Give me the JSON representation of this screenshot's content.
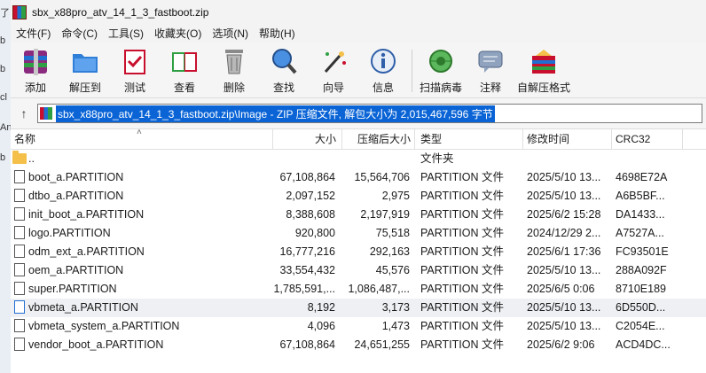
{
  "window": {
    "title": "sbx_x88pro_atv_14_1_3_fastboot.zip"
  },
  "left_strip": [
    "了",
    "b",
    "b",
    "cl",
    "Аn",
    "b"
  ],
  "menu": [
    "文件(F)",
    "命令(C)",
    "工具(S)",
    "收藏夹(O)",
    "选项(N)",
    "帮助(H)"
  ],
  "toolbar": [
    {
      "label": "添加",
      "icon": "add-archive-icon"
    },
    {
      "label": "解压到",
      "icon": "extract-to-icon"
    },
    {
      "label": "测试",
      "icon": "test-icon"
    },
    {
      "label": "查看",
      "icon": "view-book-icon"
    },
    {
      "label": "删除",
      "icon": "trash-icon"
    },
    {
      "label": "查找",
      "icon": "find-magnifier-icon"
    },
    {
      "label": "向导",
      "icon": "wizard-wand-icon"
    },
    {
      "label": "信息",
      "icon": "info-icon"
    },
    {
      "label": "扫描病毒",
      "icon": "virus-scan-icon"
    },
    {
      "label": "注释",
      "icon": "comment-icon"
    },
    {
      "label": "自解压格式",
      "icon": "sfx-icon"
    }
  ],
  "address": {
    "text": "sbx_x88pro_atv_14_1_3_fastboot.zip\\Image - ZIP 压缩文件, 解包大小为 2,015,467,596 字节"
  },
  "columns": {
    "name": "名称",
    "size": "大小",
    "packed": "压缩后大小",
    "type": "类型",
    "modified": "修改时间",
    "crc": "CRC32"
  },
  "files": [
    {
      "name": "..",
      "size": "",
      "packed": "",
      "type": "文件夹",
      "modified": "",
      "crc": ""
    },
    {
      "name": "boot_a.PARTITION",
      "size": "67,108,864",
      "packed": "15,564,706",
      "type": "PARTITION 文件",
      "modified": "2025/5/10 13...",
      "crc": "4698E72A"
    },
    {
      "name": "dtbo_a.PARTITION",
      "size": "2,097,152",
      "packed": "2,975",
      "type": "PARTITION 文件",
      "modified": "2025/5/10 13...",
      "crc": "A6B5BF..."
    },
    {
      "name": "init_boot_a.PARTITION",
      "size": "8,388,608",
      "packed": "2,197,919",
      "type": "PARTITION 文件",
      "modified": "2025/6/2 15:28",
      "crc": "DA1433..."
    },
    {
      "name": "logo.PARTITION",
      "size": "920,800",
      "packed": "75,518",
      "type": "PARTITION 文件",
      "modified": "2024/12/29 2...",
      "crc": "A7527A..."
    },
    {
      "name": "odm_ext_a.PARTITION",
      "size": "16,777,216",
      "packed": "292,163",
      "type": "PARTITION 文件",
      "modified": "2025/6/1 17:36",
      "crc": "FC93501E"
    },
    {
      "name": "oem_a.PARTITION",
      "size": "33,554,432",
      "packed": "45,576",
      "type": "PARTITION 文件",
      "modified": "2025/5/10 13...",
      "crc": "288A092F"
    },
    {
      "name": "super.PARTITION",
      "size": "1,785,591,...",
      "packed": "1,086,487,...",
      "type": "PARTITION 文件",
      "modified": "2025/6/5 0:06",
      "crc": "8710E189"
    },
    {
      "name": "vbmeta_a.PARTITION",
      "size": "8,192",
      "packed": "3,173",
      "type": "PARTITION 文件",
      "modified": "2025/5/10 13...",
      "crc": "6D550D..."
    },
    {
      "name": "vbmeta_system_a.PARTITION",
      "size": "4,096",
      "packed": "1,473",
      "type": "PARTITION 文件",
      "modified": "2025/5/10 13...",
      "crc": "C2054E..."
    },
    {
      "name": "vendor_boot_a.PARTITION",
      "size": "67,108,864",
      "packed": "24,651,255",
      "type": "PARTITION 文件",
      "modified": "2025/6/2 9:06",
      "crc": "ACD4DC..."
    }
  ],
  "selected_row": 8,
  "colors": {
    "selection": "#0a64d6",
    "accent": "#c8102e"
  }
}
